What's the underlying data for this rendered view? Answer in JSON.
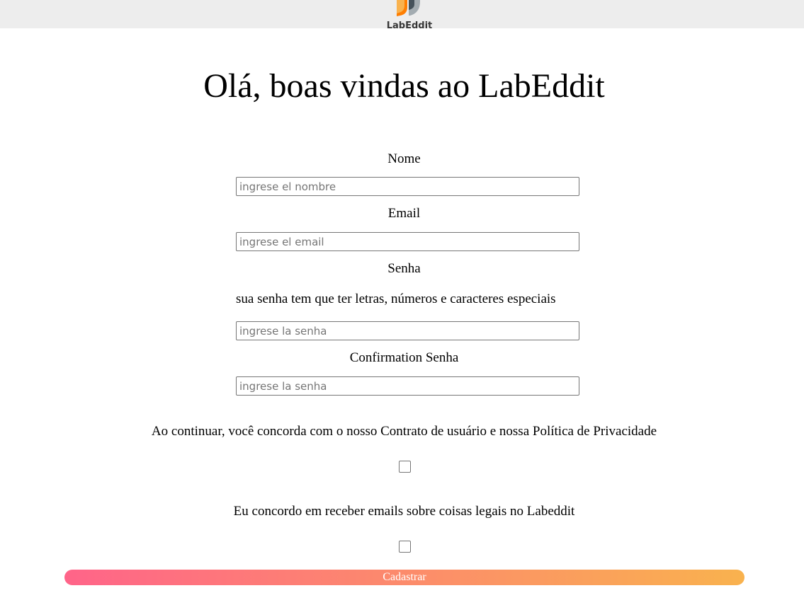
{
  "header": {
    "logo_text": "LabEddit",
    "logo_colors": {
      "orange": "#fe7e02",
      "light_orange": "#f9b24e",
      "gray_dark": "#45525b",
      "gray_light": "#a3acb1"
    }
  },
  "main": {
    "title": "Olá, boas vindas ao LabEddit",
    "name_label": "Nome",
    "name_placeholder": "ingrese el nombre",
    "name_value": "",
    "email_label": "Email",
    "email_placeholder": "ingrese el email",
    "email_value": "",
    "password_label": "Senha",
    "password_hint": "sua senha tem que ter letras, números e caracteres especiais",
    "password_placeholder": "ingrese la senha",
    "password_value": "",
    "confirm_label": "Confirmation Senha",
    "confirm_placeholder": "ingrese la senha",
    "confirm_value": "",
    "terms_text": "Ao continuar, você concorda com o nosso Contrato de usuário e nossa Política de Privacidade",
    "terms_checked": false,
    "emails_text": "Eu concordo em receber emails sobre coisas legais no Labeddit",
    "emails_checked": false,
    "submit_label": "Cadastrar",
    "submit_gradient": [
      "#ff6489",
      "#f9b24e"
    ]
  }
}
